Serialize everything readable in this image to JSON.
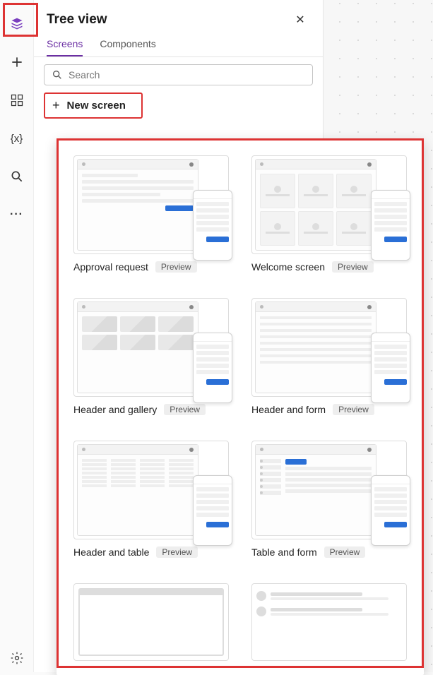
{
  "rail": {
    "icons": [
      {
        "name": "tree-view-icon",
        "color": "#7a3fbf"
      },
      {
        "name": "insert-icon"
      },
      {
        "name": "data-icon"
      },
      {
        "name": "variables-icon",
        "glyph": "{x}"
      },
      {
        "name": "search-icon"
      },
      {
        "name": "more-icon",
        "glyph": "···"
      }
    ],
    "settings_icon": "settings-icon"
  },
  "panel": {
    "title": "Tree view",
    "close_label": "✕",
    "tabs": [
      {
        "label": "Screens",
        "active": true
      },
      {
        "label": "Components",
        "active": false
      }
    ],
    "search": {
      "placeholder": "Search"
    },
    "new_screen_label": "New screen"
  },
  "gallery": {
    "badge_text": "Preview",
    "templates": [
      {
        "name": "Approval request",
        "variant": "form",
        "preview": true
      },
      {
        "name": "Welcome screen",
        "variant": "grid",
        "preview": true
      },
      {
        "name": "Header and gallery",
        "variant": "gallery",
        "preview": true
      },
      {
        "name": "Header and form",
        "variant": "rows",
        "preview": true
      },
      {
        "name": "Header and table",
        "variant": "table",
        "preview": true
      },
      {
        "name": "Table and form",
        "variant": "tform",
        "preview": true
      },
      {
        "name": "",
        "variant": "blank",
        "preview": false,
        "partial": true
      },
      {
        "name": "",
        "variant": "email",
        "preview": false,
        "partial": true
      }
    ]
  }
}
